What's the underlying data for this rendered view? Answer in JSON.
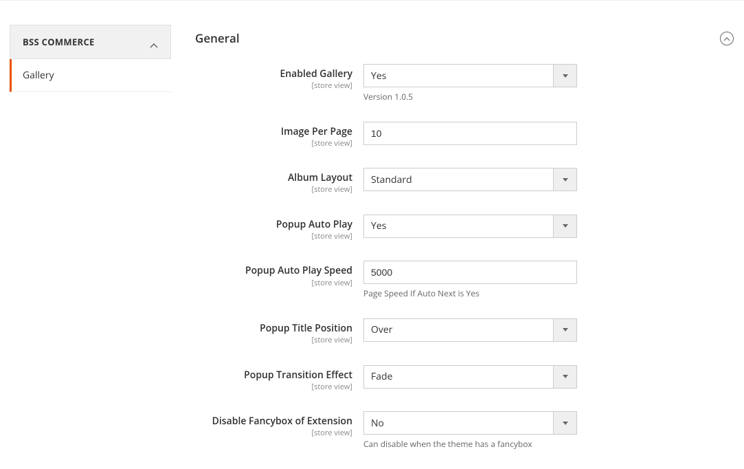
{
  "sidebar": {
    "header": "BSS COMMERCE",
    "items": [
      {
        "label": "Gallery"
      }
    ]
  },
  "section": {
    "title": "General"
  },
  "fields": {
    "scope_label": "[store view]",
    "enabled_gallery": {
      "label": "Enabled Gallery",
      "value": "Yes",
      "note": "Version 1.0.5"
    },
    "image_per_page": {
      "label": "Image Per Page",
      "value": "10"
    },
    "album_layout": {
      "label": "Album Layout",
      "value": "Standard"
    },
    "popup_auto_play": {
      "label": "Popup Auto Play",
      "value": "Yes"
    },
    "popup_auto_play_speed": {
      "label": "Popup Auto Play Speed",
      "value": "5000",
      "note": "Page Speed If Auto Next is Yes"
    },
    "popup_title_position": {
      "label": "Popup Title Position",
      "value": "Over"
    },
    "popup_transition_effect": {
      "label": "Popup Transition Effect",
      "value": "Fade"
    },
    "disable_fancybox": {
      "label": "Disable Fancybox of Extension",
      "value": "No",
      "note": "Can disable when the theme has a fancybox"
    }
  }
}
